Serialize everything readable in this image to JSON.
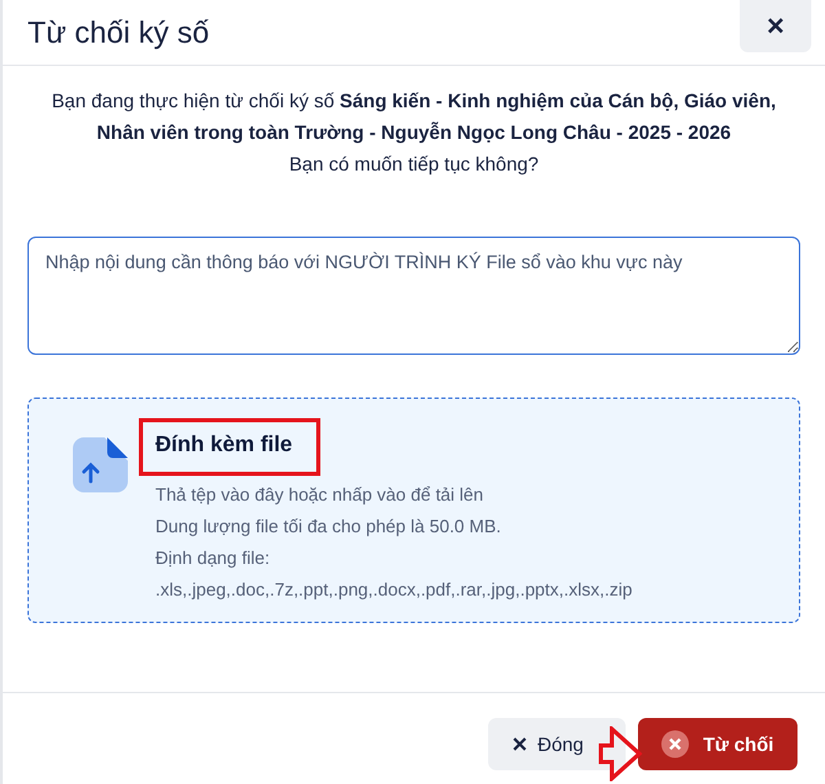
{
  "dialog": {
    "title": "Từ chối ký số",
    "close_label": "×"
  },
  "message": {
    "intro": "Bạn đang thực hiện từ chối ký số **Sáng kiến - Kinh nghiệm của Cán bộ, Giáo viên, Nhân viên trong toàn Trường - Nguyễn Ngọc Long Châu - 2025 - 2026**",
    "question": "Bạn có muốn tiếp tục không?"
  },
  "note_field": {
    "value": "Nhập nội dung cần thông báo với NGƯỜI TRÌNH KÝ File sổ vào khu vực này"
  },
  "upload": {
    "title": "Đính kèm file",
    "lines": [
      "Thả tệp vào đây hoặc nhấp vào để tải lên",
      "Dung lượng file tối đa cho phép là 50.0 MB.",
      "Định dạng file:",
      ".xls,.jpeg,.doc,.7z,.ppt,.png,.docx,.pdf,.rar,.jpg,.pptx,.xlsx,.zip"
    ]
  },
  "buttons": [
    {
      "kind": "secondary",
      "label": "Đóng"
    },
    {
      "kind": "danger",
      "label": "Từ chối"
    }
  ]
}
